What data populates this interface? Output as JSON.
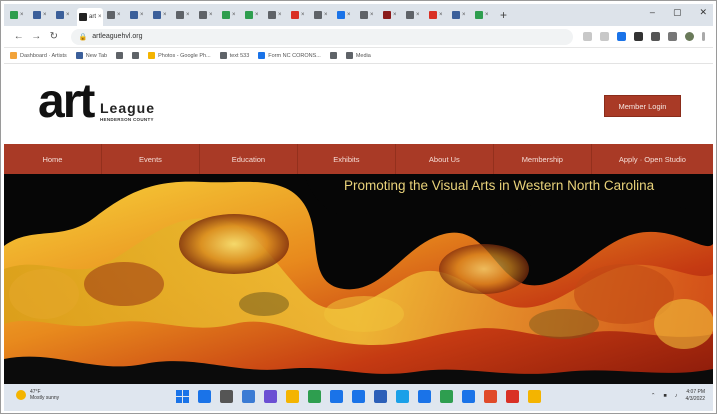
{
  "browser": {
    "tabs": [
      {
        "color": "#2e9e4f"
      },
      {
        "color": "#3b5f9a"
      },
      {
        "color": "#3b5f9a"
      },
      {
        "color": "#222222",
        "active": true,
        "label": "art"
      },
      {
        "color": "#5f6368"
      },
      {
        "color": "#3b5f9a"
      },
      {
        "color": "#3b5f9a"
      },
      {
        "color": "#5f6368"
      },
      {
        "color": "#5f6368"
      },
      {
        "color": "#2e9e4f"
      },
      {
        "color": "#2e9e4f"
      },
      {
        "color": "#5f6368"
      },
      {
        "color": "#d93025"
      },
      {
        "color": "#5f6368"
      },
      {
        "color": "#1a73e8"
      },
      {
        "color": "#5f6368"
      },
      {
        "color": "#8a1b1b"
      },
      {
        "color": "#5f6368"
      },
      {
        "color": "#d93025"
      },
      {
        "color": "#3b5f9a"
      },
      {
        "color": "#2e9e4f"
      }
    ],
    "new_tab": "+",
    "window_controls": {
      "minimize": "–",
      "maximize": "▢",
      "close": "✕"
    },
    "url": "artleaguehvl.org",
    "nav": {
      "back": "←",
      "forward": "→",
      "reload": "↻"
    },
    "bookmarks": [
      {
        "label": "Dashboard · Artists",
        "color": "#f2a33a"
      },
      {
        "label": "New Tab",
        "color": "#3b5f9a"
      },
      {
        "label": "",
        "color": "#5f6368"
      },
      {
        "label": "",
        "color": "#5f6368"
      },
      {
        "label": "Photos - Google Ph...",
        "color": "#f4b400"
      },
      {
        "label": "text 533",
        "color": "#5f6368"
      },
      {
        "label": "Form NC CORONS...",
        "color": "#1a73e8"
      },
      {
        "label": "",
        "color": "#5f6368"
      },
      {
        "label": "Media",
        "color": "#5f6368"
      }
    ]
  },
  "site": {
    "logo": {
      "art": "art",
      "league": "League",
      "county": "HENDERSON COUNTY"
    },
    "member_login": "Member Login",
    "nav": [
      "Home",
      "Events",
      "Education",
      "Exhibits",
      "About Us",
      "Membership",
      "Apply · Open Studio"
    ],
    "tagline": "Promoting the Visual Arts in Western North Carolina"
  },
  "taskbar": {
    "weather_temp": "47°F",
    "weather_desc": "Mostly sunny",
    "apps": [
      "#1a73e8",
      "#555555",
      "#3b7bd4",
      "#6b4fd3",
      "#f4b400",
      "#2e9e4f",
      "#1a73e8",
      "#1a73e8",
      "#2c5fb8",
      "#1aa0e8",
      "#1a73e8",
      "#2e9e4f",
      "#1a73e8",
      "#e04a2a",
      "#d93025",
      "#f4b400"
    ],
    "time": "4:07 PM",
    "date": "4/3/2022"
  }
}
